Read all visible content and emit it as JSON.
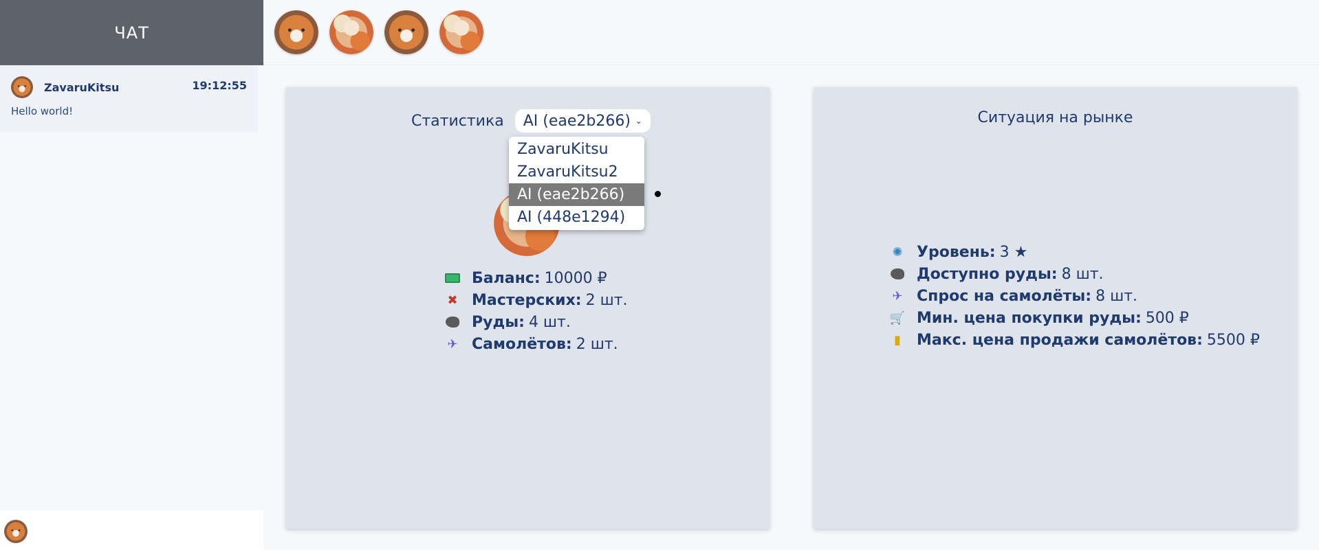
{
  "chat": {
    "title": "ЧАТ",
    "messages": [
      {
        "author": "ZavaruKitsu",
        "time": "19:12:55",
        "text": "Hello world!"
      }
    ]
  },
  "topbar": {
    "avatars": [
      "fox-avatar",
      "anime-girl-avatar",
      "fox-avatar",
      "anime-girl-avatar"
    ]
  },
  "stats": {
    "title": "Статистика",
    "selected": "AI (eae2b266)",
    "options": [
      "ZavaruKitsu",
      "ZavaruKitsu2",
      "AI (eae2b266)",
      "AI (448e1294)"
    ],
    "rows": [
      {
        "icon": "money-icon",
        "label": "Баланс:",
        "value": "10000 ₽"
      },
      {
        "icon": "tools-icon",
        "label": "Мастерских:",
        "value": "2 шт."
      },
      {
        "icon": "ore-icon",
        "label": "Руды:",
        "value": "4 шт."
      },
      {
        "icon": "airplane-icon",
        "label": "Самолётов:",
        "value": "2 шт."
      }
    ]
  },
  "market": {
    "title": "Ситуация на рынке",
    "rows": [
      {
        "icon": "swirl-icon",
        "label": "Уровень:",
        "value": "3 ★"
      },
      {
        "icon": "ore-icon",
        "label": "Доступно руды:",
        "value": "8 шт."
      },
      {
        "icon": "airplane-icon",
        "label": "Спрос на самолёты:",
        "value": "8 шт."
      },
      {
        "icon": "cart-icon",
        "label": "Мин. цена покупки руды:",
        "value": "500 ₽"
      },
      {
        "icon": "coins-icon",
        "label": "Макс. цена продажи самолётов:",
        "value": "5500 ₽"
      }
    ]
  }
}
